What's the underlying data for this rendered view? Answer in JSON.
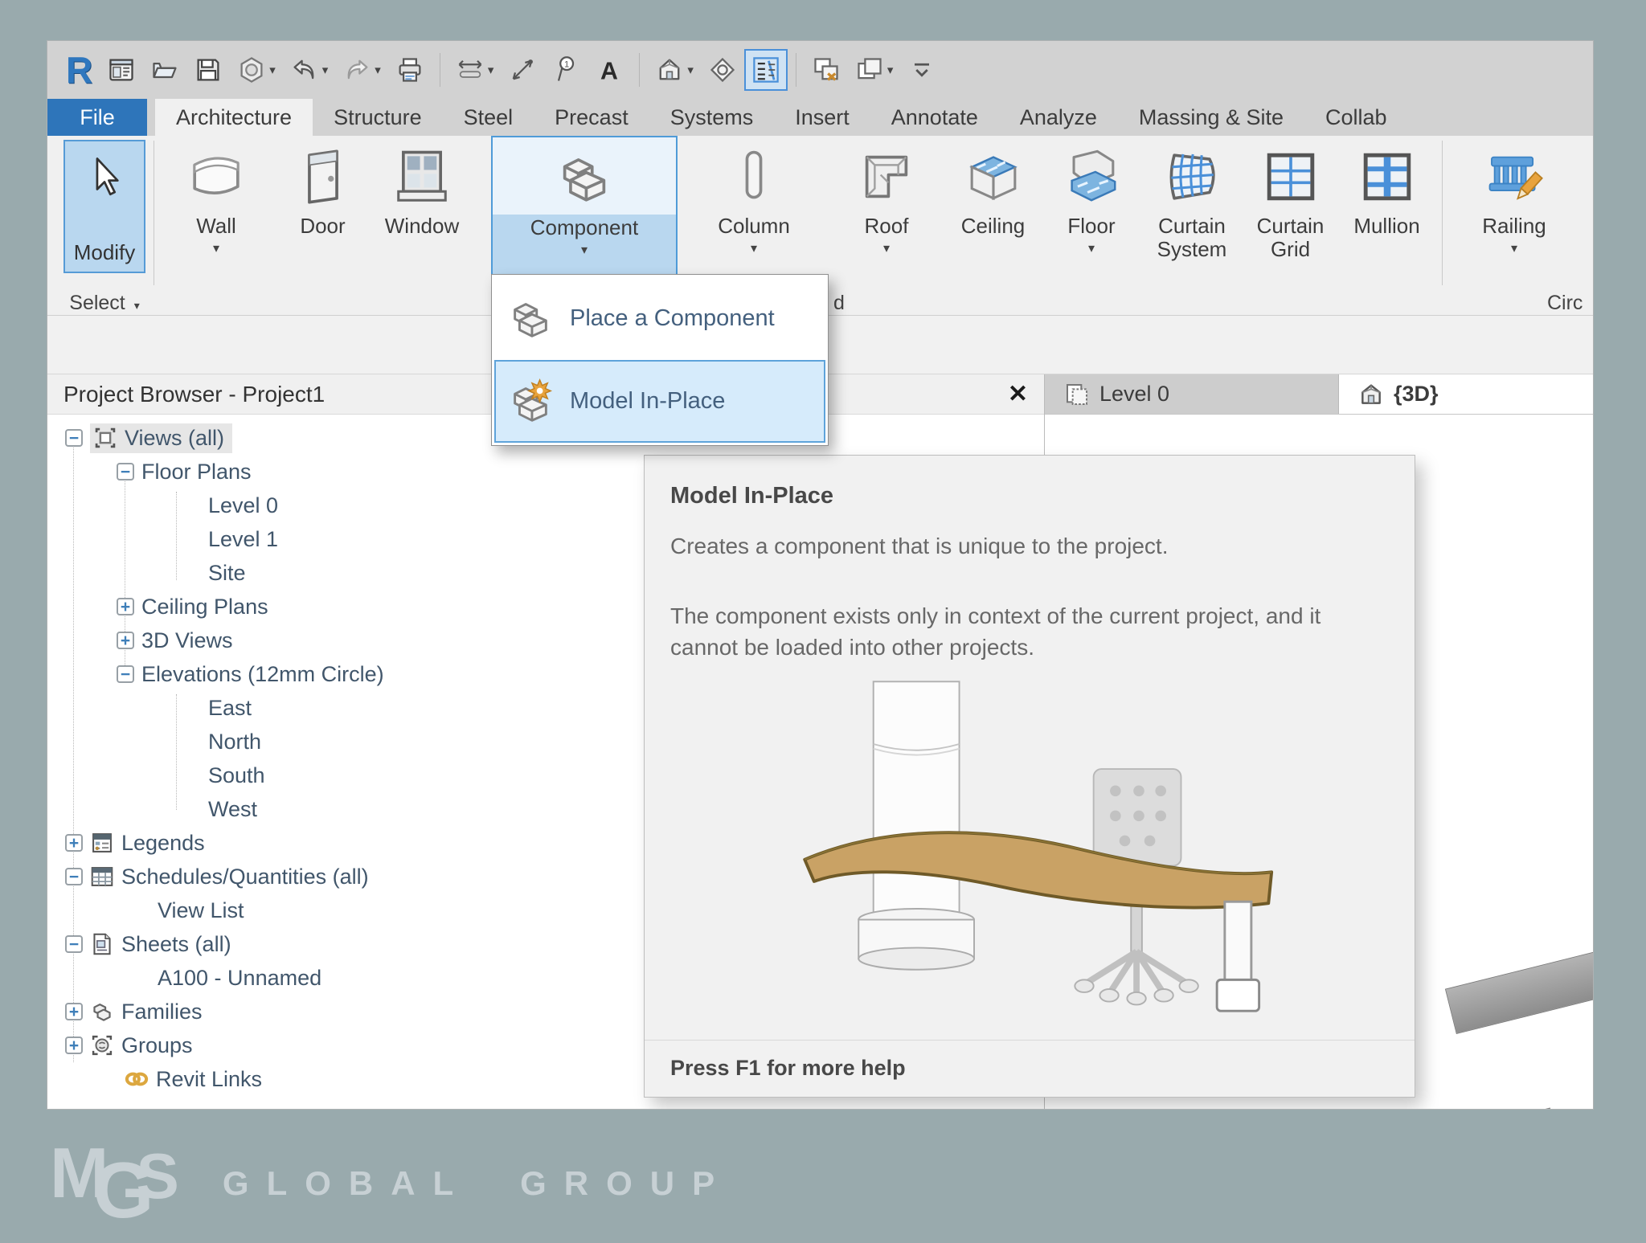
{
  "colors": {
    "accent_blue": "#2e75ba",
    "selection_fill": "#b9d7ef",
    "selection_border": "#569bd6",
    "menu_highlight": "#d6ebfb",
    "link_orange": "#dca73f",
    "canvas_green": "#99aaad"
  },
  "glyphs": {
    "caret": "▾",
    "close": "✕",
    "minus": "−",
    "plus": "+"
  },
  "qat": {
    "buttons": [
      {
        "icon": "revit-logo"
      },
      {
        "icon": "file-tabs"
      },
      {
        "icon": "open-folder"
      },
      {
        "icon": "save"
      },
      {
        "icon": "sync-with-central",
        "caret": true
      },
      {
        "icon": "undo",
        "caret": true
      },
      {
        "icon": "redo",
        "caret": true
      },
      {
        "icon": "print"
      },
      {
        "sep": true
      },
      {
        "icon": "measure",
        "caret": true
      },
      {
        "icon": "aligned-dimension"
      },
      {
        "icon": "tag-by-category"
      },
      {
        "icon": "text"
      },
      {
        "sep": true
      },
      {
        "icon": "default-3d-view",
        "caret": true
      },
      {
        "icon": "section"
      },
      {
        "icon": "thin-lines",
        "selected": true
      },
      {
        "sep": true
      },
      {
        "icon": "close-hidden-windows"
      },
      {
        "icon": "switch-windows",
        "caret": true
      },
      {
        "icon": "customize-qat"
      }
    ]
  },
  "tabs": {
    "file": "File",
    "active": "Architecture",
    "items": [
      "Architecture",
      "Structure",
      "Steel",
      "Precast",
      "Systems",
      "Insert",
      "Annotate",
      "Analyze",
      "Massing & Site",
      "Collab"
    ]
  },
  "ribbon": {
    "modify": {
      "label": "Modify"
    },
    "select_panel_label": "Select",
    "build_buttons": [
      {
        "label": "Wall",
        "icon": "wall",
        "caret": true
      },
      {
        "label": "Door",
        "icon": "door"
      },
      {
        "label": "Window",
        "icon": "window"
      },
      {
        "label": "Component",
        "icon": "component",
        "caret": true,
        "highlighted": true
      },
      {
        "label": "Column",
        "icon": "column",
        "caret": true
      },
      {
        "label": "Roof",
        "icon": "roof",
        "caret": true
      },
      {
        "label": "Ceiling",
        "icon": "ceiling"
      },
      {
        "label": "Floor",
        "icon": "floor",
        "caret": true
      },
      {
        "label": "Curtain System",
        "icon": "curtain-system"
      },
      {
        "label": "Curtain Grid",
        "icon": "curtain-grid"
      },
      {
        "label": "Mullion",
        "icon": "mullion"
      }
    ],
    "circulation_buttons": [
      {
        "label": "Railing",
        "icon": "railing",
        "caret": true
      }
    ],
    "build_label_partial": "d",
    "circulation_label_partial": "Circ"
  },
  "component_menu": {
    "items": [
      {
        "label": "Place a Component",
        "icon": "place-component"
      },
      {
        "label": "Model In-Place",
        "icon": "model-in-place",
        "highlighted": true
      }
    ]
  },
  "tooltip": {
    "title": "Model In-Place",
    "line1": "Creates a component that is unique to the project.",
    "line2": "The component exists only in context of the current project, and it cannot be loaded into other projects.",
    "footer": "Press F1 for more help"
  },
  "project_browser": {
    "title": "Project Browser - Project1",
    "tree": [
      {
        "label": "Views (all)",
        "level": 0,
        "expander": "minus",
        "icon": "views",
        "selected": true
      },
      {
        "label": "Floor Plans",
        "level": 1,
        "expander": "minus"
      },
      {
        "label": "Level 0",
        "level": 2
      },
      {
        "label": "Level 1",
        "level": 2
      },
      {
        "label": "Site",
        "level": 2
      },
      {
        "label": "Ceiling Plans",
        "level": 1,
        "expander": "plus"
      },
      {
        "label": "3D Views",
        "level": 1,
        "expander": "plus"
      },
      {
        "label": "Elevations (12mm Circle)",
        "level": 1,
        "expander": "minus"
      },
      {
        "label": "East",
        "level": 2
      },
      {
        "label": "North",
        "level": 2
      },
      {
        "label": "South",
        "level": 2
      },
      {
        "label": "West",
        "level": 2
      },
      {
        "label": "Legends",
        "level": 0,
        "expander": "plus",
        "icon": "legends"
      },
      {
        "label": "Schedules/Quantities (all)",
        "level": 0,
        "expander": "minus",
        "icon": "schedules"
      },
      {
        "label": "View List",
        "level": 1
      },
      {
        "label": "Sheets (all)",
        "level": 0,
        "expander": "minus",
        "icon": "sheets"
      },
      {
        "label": "A100 - Unnamed",
        "level": 1
      },
      {
        "label": "Families",
        "level": 0,
        "expander": "plus",
        "icon": "families"
      },
      {
        "label": "Groups",
        "level": 0,
        "expander": "plus",
        "icon": "groups"
      },
      {
        "label": "Revit Links",
        "level": 0,
        "icon": "revit-links"
      }
    ]
  },
  "view_tabs": [
    {
      "label": "Level 0",
      "icon": "plan-view",
      "active": false
    },
    {
      "label": "{3D}",
      "icon": "3d-view",
      "active": true
    }
  ],
  "logo": {
    "m": "M",
    "g": "G",
    "s": "S",
    "text": "GLOBAL GROUP"
  }
}
